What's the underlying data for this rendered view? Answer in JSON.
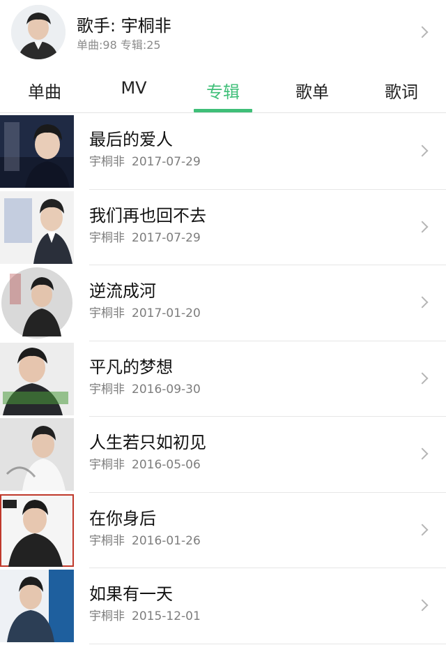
{
  "header": {
    "singer_label": "歌手: 宇桐非",
    "stats": "单曲:98 专辑:25",
    "avatar_icon": "singer-avatar",
    "chevron_icon": "chevron-right-icon"
  },
  "tabs": [
    {
      "label": "单曲",
      "active": false
    },
    {
      "label": "MV",
      "active": false
    },
    {
      "label": "专辑",
      "active": true
    },
    {
      "label": "歌单",
      "active": false
    },
    {
      "label": "歌词",
      "active": false
    }
  ],
  "accent_color": "#3fbf78",
  "albums": [
    {
      "title": "最后的爱人",
      "artist": "宇桐非",
      "date": "2017-07-29",
      "cover_bg": "#1f2a44"
    },
    {
      "title": "我们再也回不去",
      "artist": "宇桐非",
      "date": "2017-07-29",
      "cover_bg": "#f2f2f2"
    },
    {
      "title": "逆流成河",
      "artist": "宇桐非",
      "date": "2017-01-20",
      "cover_bg": "#d9d9d9"
    },
    {
      "title": "平凡的梦想",
      "artist": "宇桐非",
      "date": "2016-09-30",
      "cover_bg": "#ededed"
    },
    {
      "title": "人生若只如初见",
      "artist": "宇桐非",
      "date": "2016-05-06",
      "cover_bg": "#e2e2e2"
    },
    {
      "title": "在你身后",
      "artist": "宇桐非",
      "date": "2016-01-26",
      "cover_bg": "#f5f5f5"
    },
    {
      "title": "如果有一天",
      "artist": "宇桐非",
      "date": "2015-12-01",
      "cover_bg": "#1e5f9e"
    }
  ]
}
